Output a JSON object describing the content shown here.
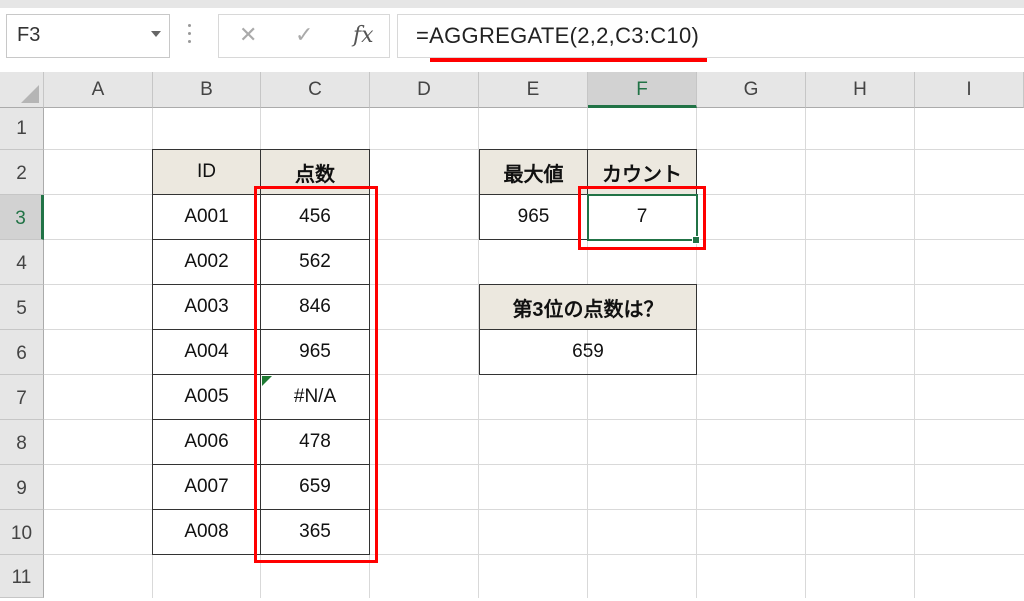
{
  "namebox": {
    "value": "F3"
  },
  "formula_bar": {
    "cancel_symbol": "✕",
    "enter_symbol": "✓",
    "fx_label": "fx",
    "formula": "=AGGREGATE(2,2,C3:C10)"
  },
  "columns": [
    "A",
    "B",
    "C",
    "D",
    "E",
    "F",
    "G",
    "H",
    "I"
  ],
  "rows": [
    "1",
    "2",
    "3",
    "4",
    "5",
    "6",
    "7",
    "8",
    "9",
    "10",
    "11"
  ],
  "table": {
    "header_id": "ID",
    "header_score": "点数",
    "ids": [
      "A001",
      "A002",
      "A003",
      "A004",
      "A005",
      "A006",
      "A007",
      "A008"
    ],
    "scores": [
      "456",
      "562",
      "846",
      "965",
      "#N/A",
      "478",
      "659",
      "365"
    ]
  },
  "summary": {
    "max_label": "最大値",
    "count_label": "カウント",
    "max_value": "965",
    "count_value": "7"
  },
  "rank": {
    "label": "第3位の点数は？",
    "value": "659"
  },
  "colors": {
    "accent_green": "#217346",
    "highlight_red": "#ff0000",
    "header_fill": "#ece8df"
  }
}
